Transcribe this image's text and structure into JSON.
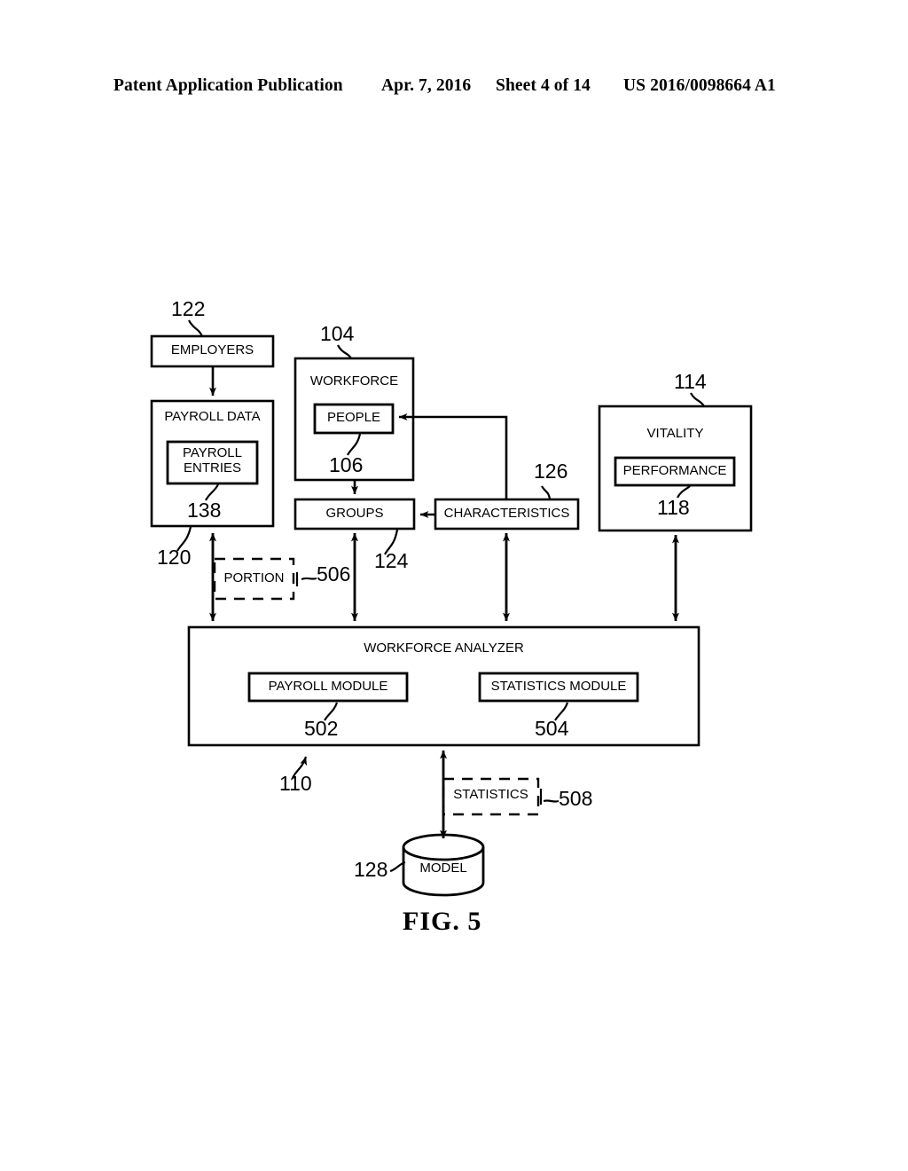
{
  "header": {
    "publication": "Patent Application Publication",
    "date": "Apr. 7, 2016",
    "sheet": "Sheet 4 of 14",
    "number": "US 2016/0098664 A1"
  },
  "figure": {
    "caption": "FIG. 5",
    "boxes": {
      "employers": "EMPLOYERS",
      "payroll_data": "PAYROLL DATA",
      "payroll_entries_line1": "PAYROLL",
      "payroll_entries_line2": "ENTRIES",
      "workforce": "WORKFORCE",
      "people": "PEOPLE",
      "groups": "GROUPS",
      "characteristics": "CHARACTERISTICS",
      "vitality": "VITALITY",
      "performance": "PERFORMANCE",
      "portion": "PORTION",
      "workforce_analyzer": "WORKFORCE ANALYZER",
      "payroll_module": "PAYROLL MODULE",
      "statistics_module": "STATISTICS MODULE",
      "statistics": "STATISTICS",
      "model": "MODEL"
    },
    "reference_numerals": {
      "employers": "122",
      "workforce": "104",
      "vitality": "114",
      "people": "106",
      "payroll_entries": "138",
      "performance": "118",
      "characteristics": "126",
      "groups": "124",
      "payroll_data": "120",
      "portion": "506",
      "payroll_module": "502",
      "statistics_module": "504",
      "workforce_analyzer": "110",
      "statistics": "508",
      "model": "128"
    }
  }
}
